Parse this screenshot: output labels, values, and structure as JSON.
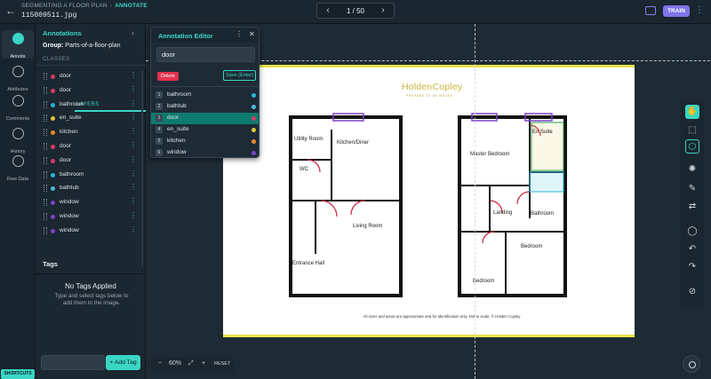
{
  "topbar": {
    "breadcrumb": "SEGMENTING A FLOOR PLAN",
    "mode": "ANNOTATE",
    "filename": "115009511.jpg",
    "pager": "1 / 50",
    "train": "TRAIN"
  },
  "rail": [
    {
      "label": "Annots",
      "icon": "layers-icon"
    },
    {
      "label": "Attributes",
      "icon": "tag-icon"
    },
    {
      "label": "Comments",
      "icon": "comment-icon"
    },
    {
      "label": "History",
      "icon": "history-icon"
    },
    {
      "label": "Raw Data",
      "icon": "database-icon"
    }
  ],
  "shortcuts": "SHORTCUTS",
  "panel": {
    "title": "Annotations",
    "group_label": "Group:",
    "group_value": "Parts-of-a-floor-plan",
    "tab_classes": "CLASSES",
    "tab_layers": "LAYERS"
  },
  "layers": [
    {
      "name": "door",
      "color": "#d83a6a"
    },
    {
      "name": "door",
      "color": "#d83a6a"
    },
    {
      "name": "bathroom",
      "color": "#27b6d8"
    },
    {
      "name": "en_suite",
      "color": "#e2c43a"
    },
    {
      "name": "kitchen",
      "color": "#e58a2e"
    },
    {
      "name": "door",
      "color": "#d83a6a"
    },
    {
      "name": "door",
      "color": "#d83a6a"
    },
    {
      "name": "bathroom",
      "color": "#27b6d8"
    },
    {
      "name": "bathtub",
      "color": "#4fb9d9"
    },
    {
      "name": "window",
      "color": "#7b45c8"
    },
    {
      "name": "window",
      "color": "#7b45c8"
    },
    {
      "name": "window",
      "color": "#7b45c8"
    }
  ],
  "tags": {
    "title": "Tags",
    "empty": "No Tags Applied",
    "hint": "Type and select tags below to add them to the image.",
    "add_button": "+ Add Tag"
  },
  "editor": {
    "title": "Annotation Editor",
    "value": "door",
    "delete": "Delete",
    "save": "Save (Enter)",
    "options": [
      {
        "num": "1",
        "label": "bathroom",
        "color": "#27b6d8"
      },
      {
        "num": "2",
        "label": "bathtub",
        "color": "#4fb9d9"
      },
      {
        "num": "3",
        "label": "door",
        "color": "#d83a6a",
        "selected": true
      },
      {
        "num": "4",
        "label": "en_suite",
        "color": "#e2c43a"
      },
      {
        "num": "5",
        "label": "kitchen",
        "color": "#e58a2e"
      },
      {
        "num": "6",
        "label": "window",
        "color": "#7b45c8"
      }
    ]
  },
  "plan": {
    "brand": "HoldenCopley",
    "brand_sub": "PREPARE TO BE MOVED",
    "rooms": {
      "utility": "Utility Room",
      "kitchen": "Kitchen/Diner",
      "wc": "WC",
      "living": "Living Room",
      "hall": "Entrance Hall",
      "master": "Master Bedroom",
      "ensuite": "En Suite",
      "landing": "Landing",
      "bathroom": "Bathroom",
      "bedroom2": "Bedroom",
      "bedroom3": "Bedroom"
    },
    "footer": "All sizes and areas are approximate and for identification only. Not to scale. © Holden Copley"
  },
  "zoom": {
    "value": "60%",
    "reset": "RESET"
  }
}
